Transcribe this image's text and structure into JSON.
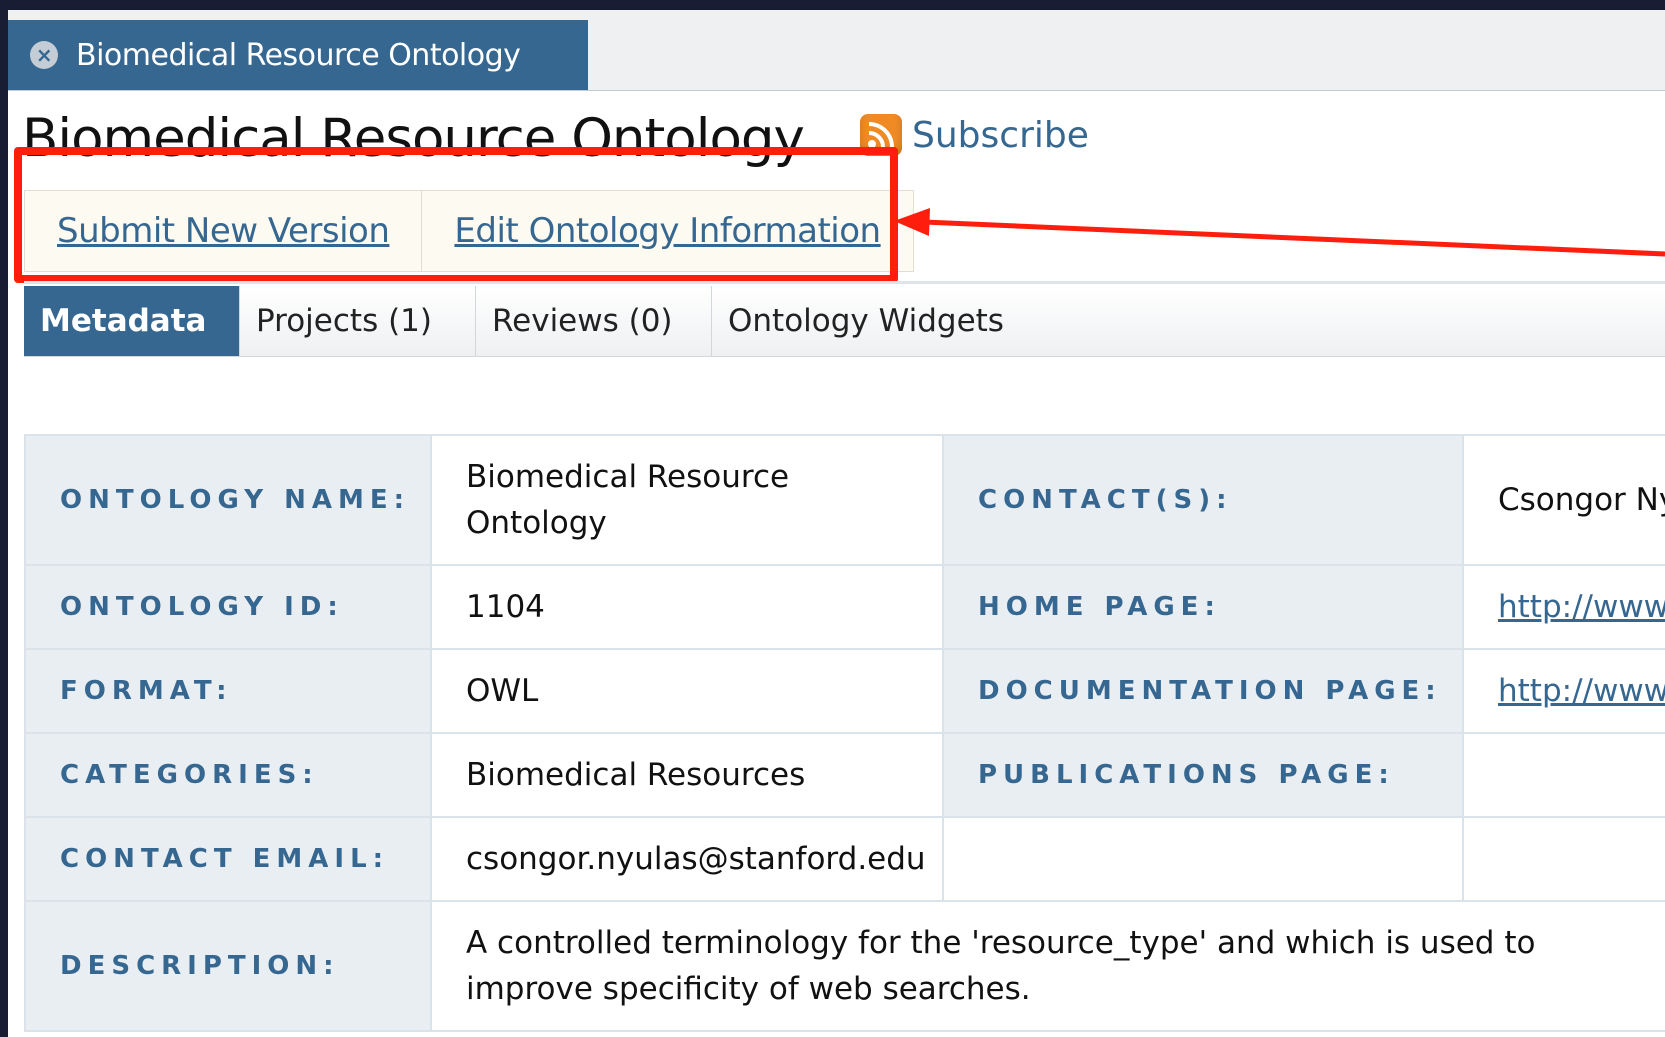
{
  "tab": {
    "title": "Biomedical Resource Ontology"
  },
  "header": {
    "title": "Biomedical Resource Ontology",
    "subscribe_label": "Subscribe"
  },
  "actions": [
    {
      "label": "Submit New Version"
    },
    {
      "label": "Edit Ontology Information"
    }
  ],
  "subtabs": [
    {
      "label": "Metadata",
      "active": true
    },
    {
      "label": "Projects (1)"
    },
    {
      "label": "Reviews (0)"
    },
    {
      "label": "Ontology Widgets"
    }
  ],
  "metadata": {
    "ontology_name_label": "ONTOLOGY NAME:",
    "ontology_name": "Biomedical Resource Ontology",
    "contacts_label": "CONTACT(S):",
    "contacts": "Csongor Ny",
    "ontology_id_label": "ONTOLOGY ID:",
    "ontology_id": "1104",
    "home_page_label": "HOME PAGE:",
    "home_page": "http://www",
    "format_label": "FORMAT:",
    "format": "OWL",
    "documentation_page_label": "DOCUMENTATION PAGE:",
    "documentation_page": "http://www",
    "categories_label": "CATEGORIES:",
    "categories": "Biomedical Resources",
    "publications_page_label": "PUBLICATIONS PAGE:",
    "contact_email_label": "CONTACT EMAIL:",
    "contact_email": "csongor.nyulas@stanford.edu",
    "description_label": "DESCRIPTION:",
    "description": "A controlled terminology for the 'resource_type' and which is used to improve specificity of web searches."
  },
  "colors": {
    "brand": "#366790",
    "highlight": "#ff1d0e",
    "rss": "#f08a24"
  }
}
